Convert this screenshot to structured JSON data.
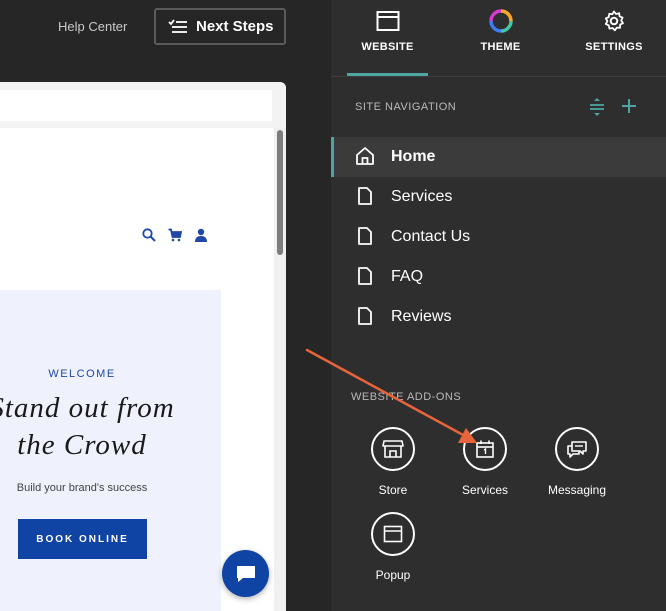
{
  "topbar": {
    "help_label": "Help Center",
    "next_steps_label": "Next Steps"
  },
  "preview": {
    "welcome": "WELCOME",
    "headline_line1": "Stand out from",
    "headline_line2": "the Crowd",
    "tagline": "Build your brand's success",
    "book_button": "BOOK ONLINE",
    "header_icons": [
      "search-icon",
      "cart-icon",
      "account-icon"
    ]
  },
  "tabs": [
    {
      "label": "WEBSITE",
      "icon": "browser-window-icon",
      "active": true
    },
    {
      "label": "THEME",
      "icon": "color-wheel-icon",
      "active": false
    },
    {
      "label": "SETTINGS",
      "icon": "gear-icon",
      "active": false
    }
  ],
  "site_navigation": {
    "title": "SITE NAVIGATION",
    "items": [
      {
        "label": "Home",
        "icon": "home-icon",
        "active": true
      },
      {
        "label": "Services",
        "icon": "page-icon",
        "active": false
      },
      {
        "label": "Contact Us",
        "icon": "page-icon",
        "active": false
      },
      {
        "label": "FAQ",
        "icon": "page-icon",
        "active": false
      },
      {
        "label": "Reviews",
        "icon": "page-icon",
        "active": false
      }
    ]
  },
  "addons": {
    "title": "WEBSITE ADD-ONS",
    "items": [
      {
        "label": "Store",
        "icon": "store-icon"
      },
      {
        "label": "Services",
        "icon": "calendar-icon"
      },
      {
        "label": "Messaging",
        "icon": "chat-bubbles-icon"
      },
      {
        "label": "Popup",
        "icon": "popup-window-icon"
      }
    ]
  },
  "colors": {
    "accent": "#4ea4a0",
    "preview_brand": "#0f43a4",
    "annotation_arrow": "#e8643a",
    "panel_bg": "#2e2e2e"
  }
}
